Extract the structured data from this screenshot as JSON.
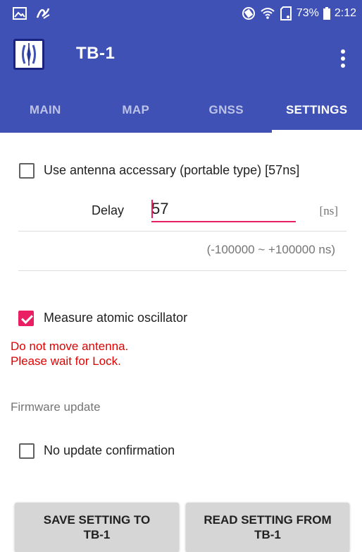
{
  "statusbar": {
    "battery_percent": "73%",
    "time": "2:12",
    "icons": [
      "image-icon",
      "notification-icon",
      "rotate-icon",
      "wifi-icon",
      "sd-card-icon",
      "battery-icon"
    ]
  },
  "app": {
    "title": "TB-1",
    "logo_icon": "tb-logo-icon",
    "overflow_icon": "more-vert-icon",
    "colors": {
      "primary": "#3f51b5",
      "accent": "#e91e63",
      "warning": "#e00000"
    }
  },
  "tabs": [
    {
      "label": "MAIN",
      "active": false
    },
    {
      "label": "MAP",
      "active": false
    },
    {
      "label": "GNSS",
      "active": false
    },
    {
      "label": "SETTINGS",
      "active": true
    }
  ],
  "settings": {
    "antenna_accessory": {
      "label": "Use antenna accessary (portable type) [57ns]",
      "checked": false
    },
    "delay": {
      "label": "Delay",
      "value": "57",
      "unit": "[ns]",
      "range": "(-100000 ~ +100000 ns)"
    },
    "atomic_oscillator": {
      "label": "Measure atomic oscillator",
      "checked": true
    },
    "warning_line1": "Do not move antenna.",
    "warning_line2": "Please wait for Lock.",
    "firmware_section": "Firmware update",
    "no_update_confirmation": {
      "label": "No update confirmation",
      "checked": false
    }
  },
  "buttons": {
    "save_line1": "SAVE SETTING TO",
    "save_line2": "TB-1",
    "read_line1": "READ SETTING FROM",
    "read_line2": "TB-1"
  }
}
